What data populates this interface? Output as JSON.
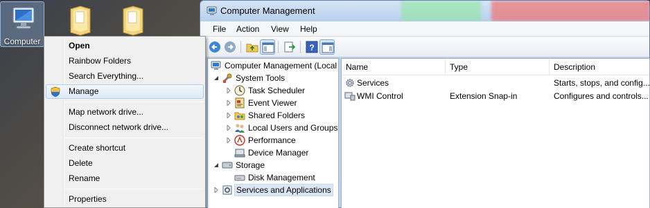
{
  "desktop": {
    "computer_label": "Computer"
  },
  "context_menu": {
    "items": [
      {
        "label": "Open"
      },
      {
        "label": "Rainbow Folders"
      },
      {
        "label": "Search Everything..."
      },
      {
        "label": "Manage"
      },
      {
        "label": "Map network drive..."
      },
      {
        "label": "Disconnect network drive..."
      },
      {
        "label": "Create shortcut"
      },
      {
        "label": "Delete"
      },
      {
        "label": "Rename"
      },
      {
        "label": "Properties"
      }
    ]
  },
  "window": {
    "title": "Computer Management",
    "menus": [
      "File",
      "Action",
      "View",
      "Help"
    ],
    "toolbar_icons": [
      "back-arrow-icon",
      "forward-arrow-icon",
      "up-folder-icon",
      "show-hide-tree-icon",
      "export-list-icon",
      "help-icon",
      "show-hide-action-pane-icon"
    ]
  },
  "tree": {
    "items": [
      {
        "label": "Computer Management (Local",
        "icon": "computer-management-icon"
      },
      {
        "label": "System Tools",
        "icon": "tools-icon"
      },
      {
        "label": "Task Scheduler",
        "icon": "clock-icon"
      },
      {
        "label": "Event Viewer",
        "icon": "event-viewer-icon"
      },
      {
        "label": "Shared Folders",
        "icon": "shared-folder-icon"
      },
      {
        "label": "Local Users and Groups",
        "icon": "users-icon"
      },
      {
        "label": "Performance",
        "icon": "performance-icon"
      },
      {
        "label": "Device Manager",
        "icon": "device-manager-icon"
      },
      {
        "label": "Storage",
        "icon": "storage-icon"
      },
      {
        "label": "Disk Management",
        "icon": "disk-icon"
      },
      {
        "label": "Services and Applications",
        "icon": "services-apps-icon"
      }
    ]
  },
  "list": {
    "columns": [
      "Name",
      "Type",
      "Description"
    ],
    "rows": [
      {
        "name": "Services",
        "type": "",
        "description": "Starts, stops, and config...",
        "icon": "gear-icon"
      },
      {
        "name": "WMI Control",
        "type": "Extension Snap-in",
        "description": "Configures and controls...",
        "icon": "wmi-icon"
      }
    ]
  },
  "colors": {
    "menu_highlight_border": "#aecff7",
    "tree_selected_bg": "#dbe6f3"
  }
}
